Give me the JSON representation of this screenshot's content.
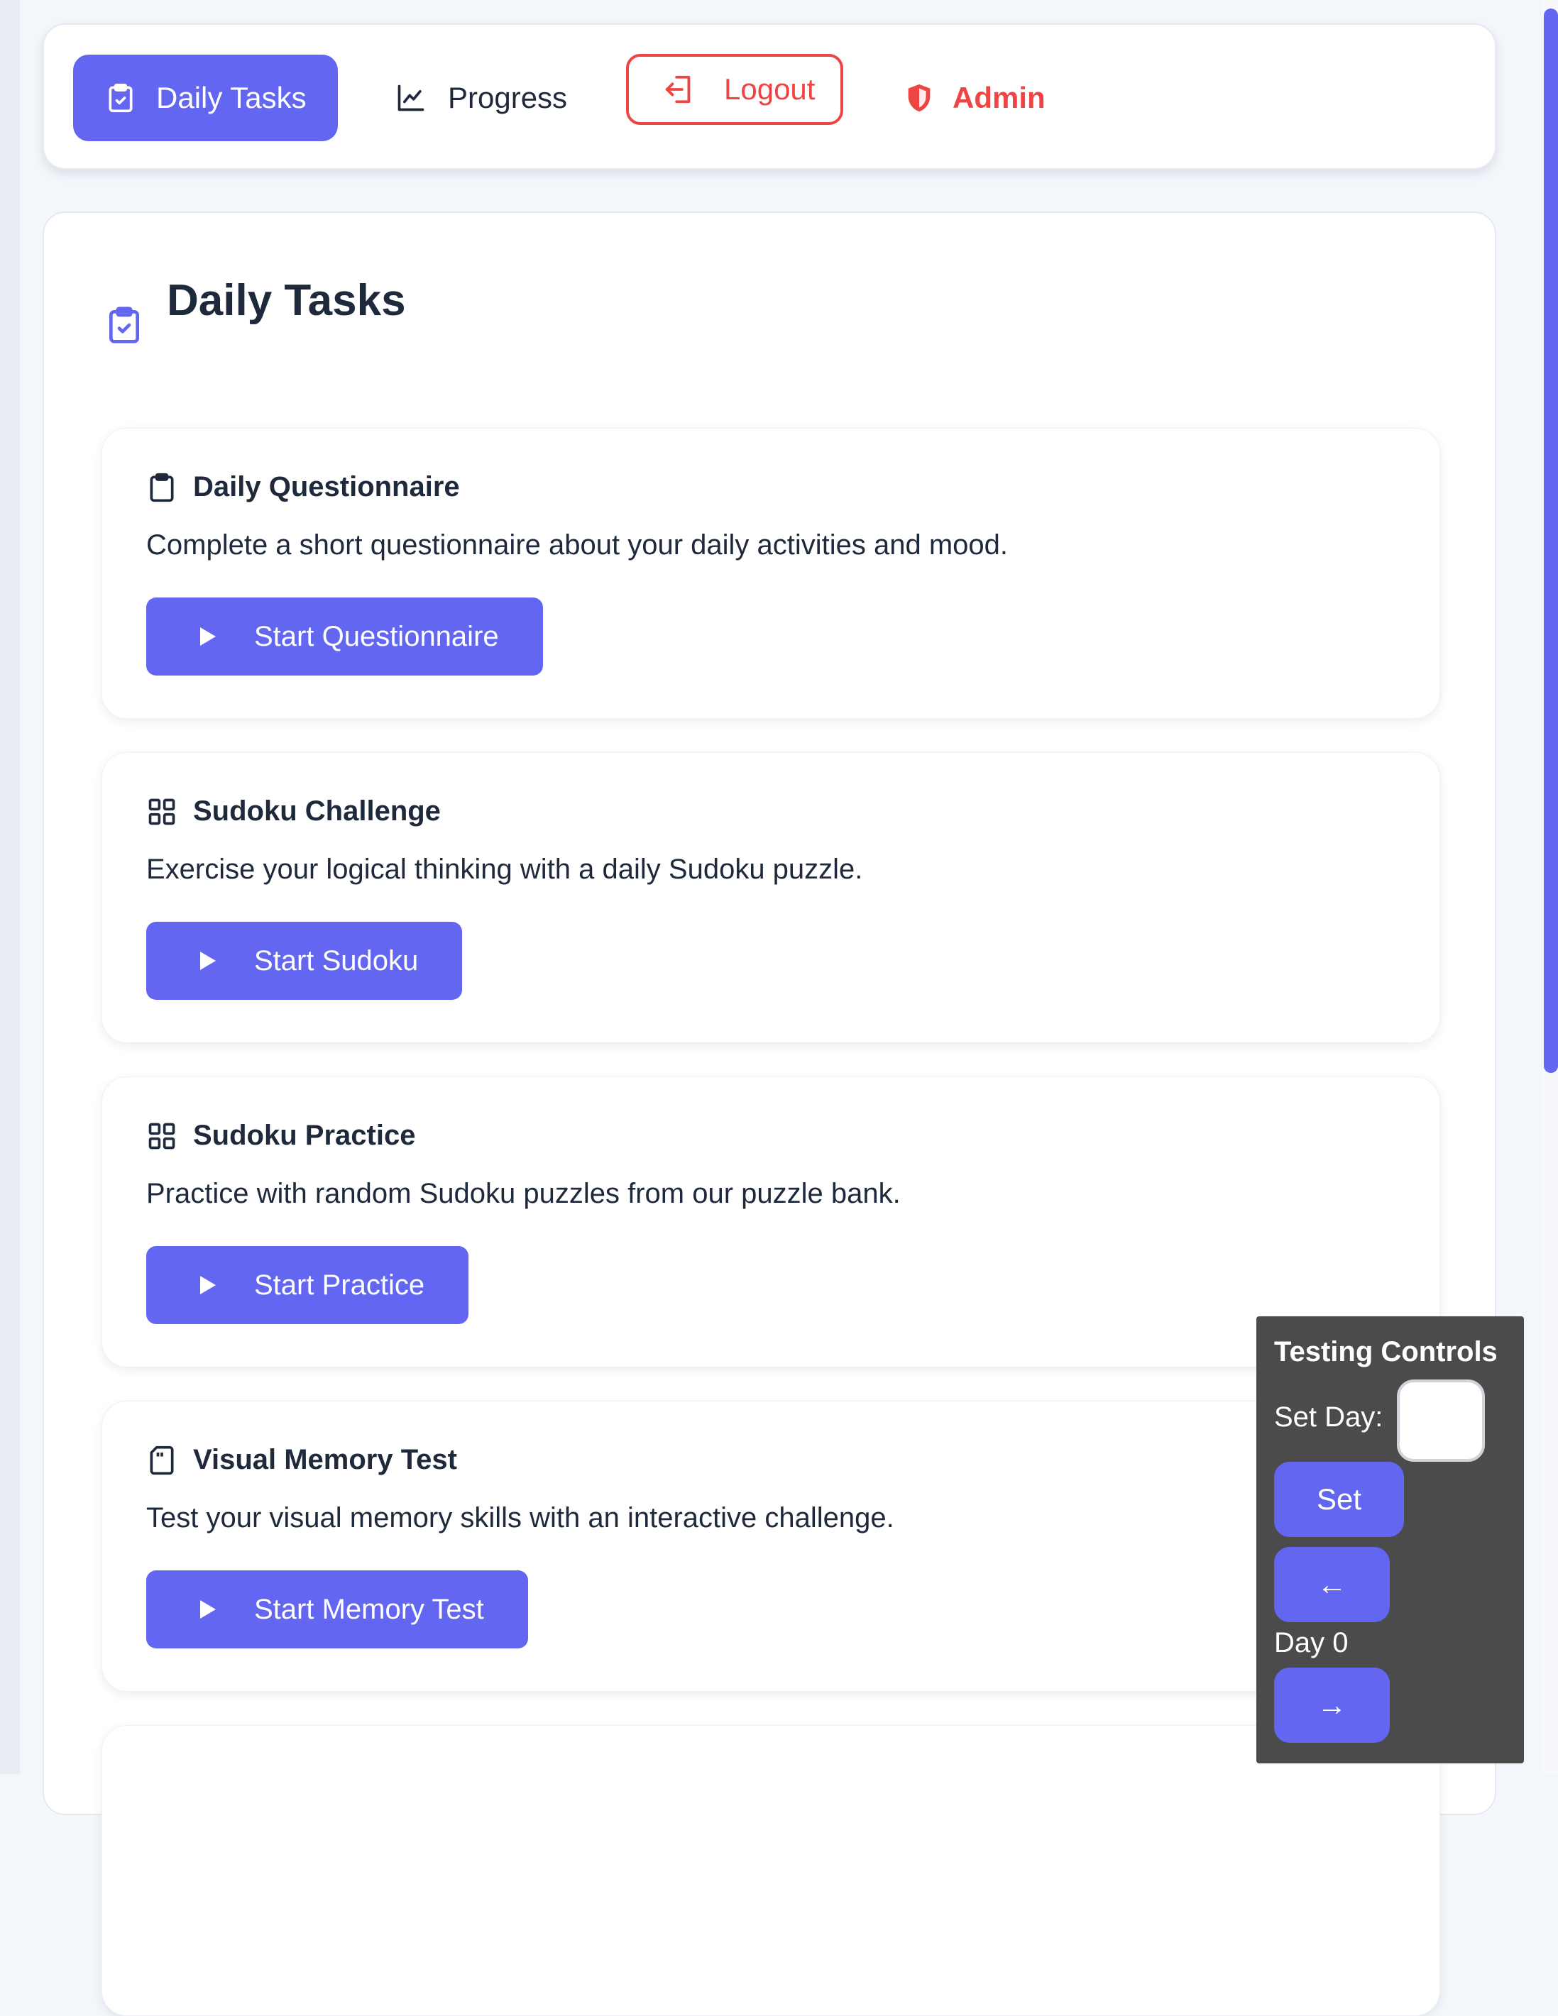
{
  "nav": {
    "daily_tasks": "Daily Tasks",
    "progress": "Progress",
    "logout": "Logout",
    "admin": "Admin"
  },
  "page": {
    "title": "Daily Tasks"
  },
  "tasks": [
    {
      "icon": "clipboard-icon",
      "title": "Daily Questionnaire",
      "description": "Complete a short questionnaire about your daily activities and mood.",
      "button": "Start Questionnaire"
    },
    {
      "icon": "grid-icon",
      "title": "Sudoku Challenge",
      "description": "Exercise your logical thinking with a daily Sudoku puzzle.",
      "button": "Start Sudoku"
    },
    {
      "icon": "grid-icon",
      "title": "Sudoku Practice",
      "description": "Practice with random Sudoku puzzles from our puzzle bank.",
      "button": "Start Practice"
    },
    {
      "icon": "sd-card-icon",
      "title": "Visual Memory Test",
      "description": "Test your visual memory skills with an interactive challenge.",
      "button": "Start Memory Test"
    }
  ],
  "testing": {
    "title": "Testing Controls",
    "set_day_label": "Set Day:",
    "day_input_value": "",
    "set_button": "Set",
    "prev_button": "←",
    "day_display": "Day 0",
    "next_button": "→"
  },
  "colors": {
    "accent": "#6366f1",
    "danger": "#ef4444",
    "text": "#1e293b",
    "panel": "#4b4b4b"
  }
}
